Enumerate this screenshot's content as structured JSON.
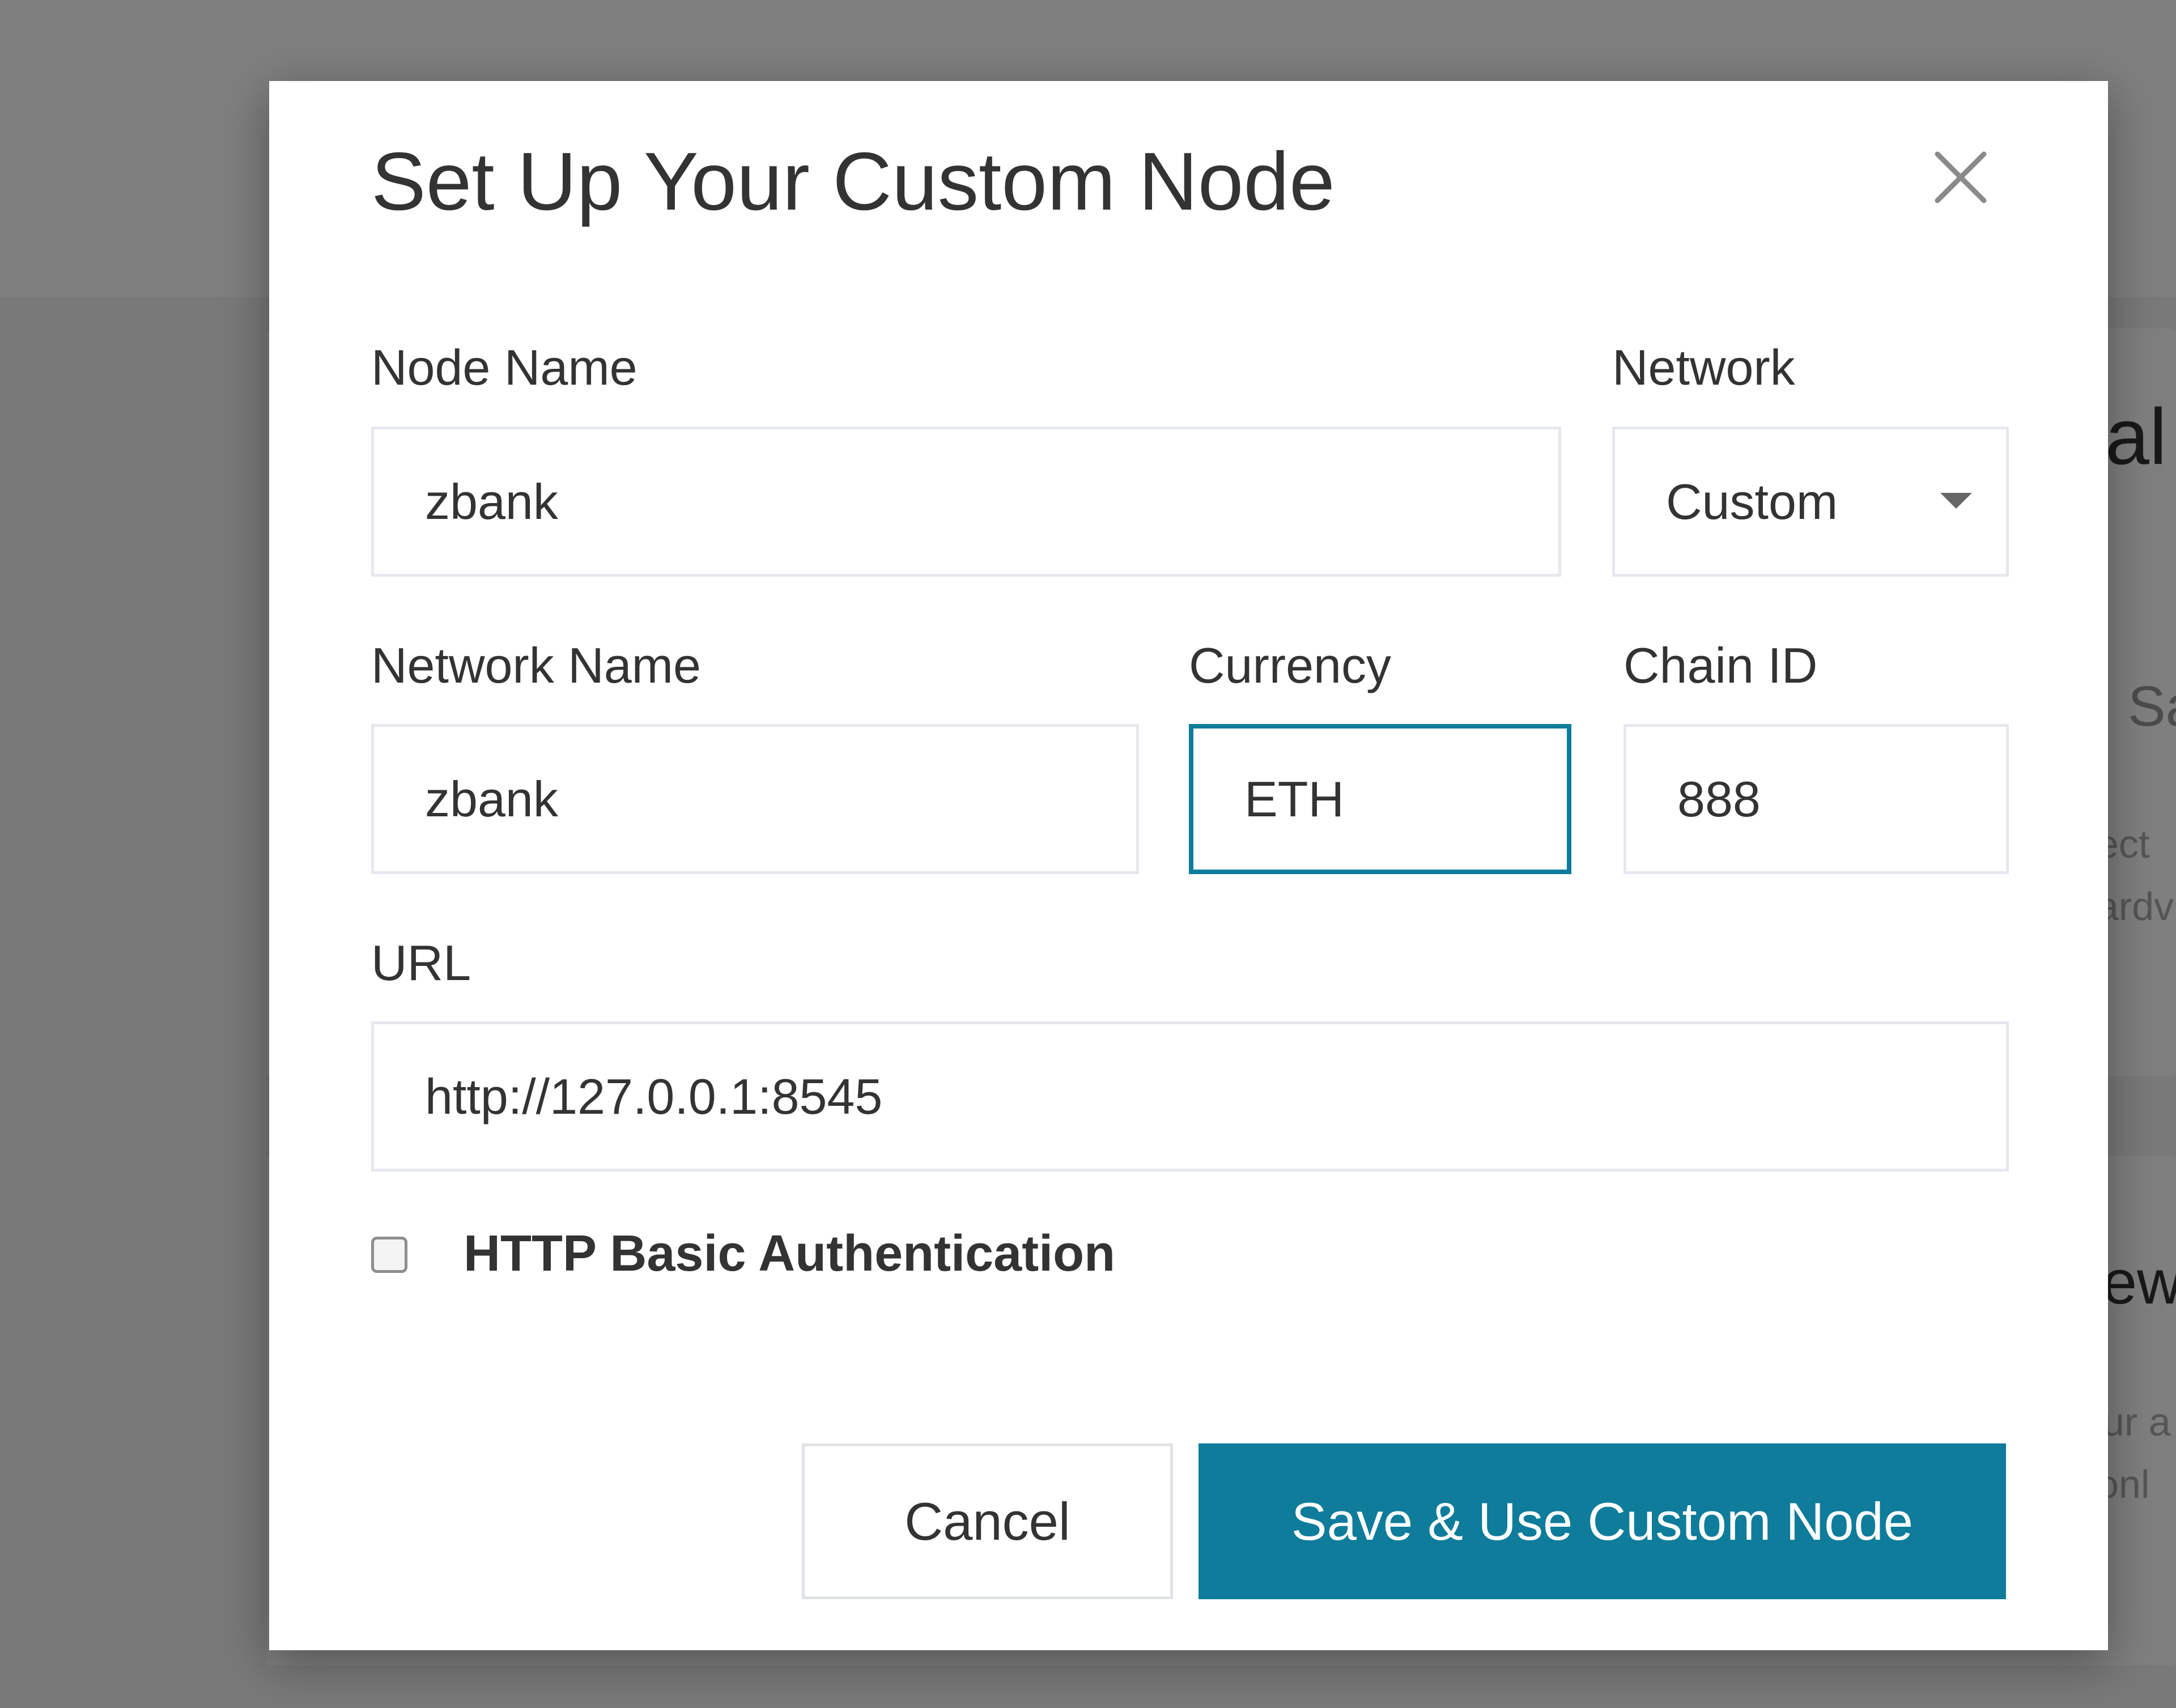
{
  "background": {
    "fragments": [
      "al",
      "Sa",
      "ect",
      "ardv",
      "ew",
      "ur a",
      "onl"
    ]
  },
  "modal": {
    "title": "Set Up Your Custom Node",
    "close_icon": "close-icon",
    "fields": {
      "node_name": {
        "label": "Node Name",
        "value": "zbank"
      },
      "network": {
        "label": "Network",
        "value": "Custom"
      },
      "network_name": {
        "label": "Network Name",
        "value": "zbank"
      },
      "currency": {
        "label": "Currency",
        "value": "ETH"
      },
      "chain_id": {
        "label": "Chain ID",
        "value": "888"
      },
      "url": {
        "label": "URL",
        "value": "http://127.0.0.1:8545"
      }
    },
    "checkbox": {
      "label": "HTTP Basic Authentication",
      "checked": false
    },
    "buttons": {
      "cancel": "Cancel",
      "save": "Save & Use Custom Node"
    }
  },
  "colors": {
    "accent": "#0e7c9a",
    "overlay": "rgba(0,0,0,0.5)"
  }
}
